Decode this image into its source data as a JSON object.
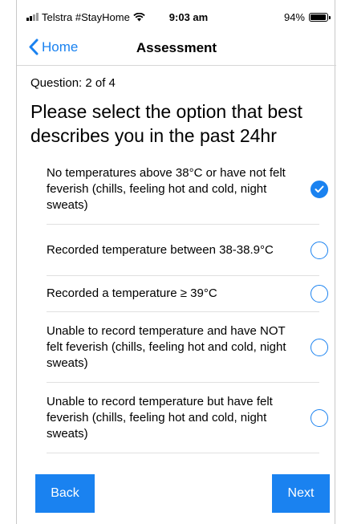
{
  "status_bar": {
    "carrier": "Telstra #StayHome",
    "time": "9:03 am",
    "battery": "94%",
    "battery_level": 0.94
  },
  "nav": {
    "back_label": "Home",
    "title": "Assessment"
  },
  "question": {
    "counter": "Question: 2 of 4",
    "text": "Please select the option that best describes you in the past 24hr"
  },
  "options": [
    {
      "label": "No temperatures above 38°C or have not felt feverish (chills, feeling hot and cold, night sweats)",
      "selected": true
    },
    {
      "label": "Recorded temperature between 38-38.9°C",
      "selected": false
    },
    {
      "label": "Recorded a temperature ≥ 39°C",
      "selected": false
    },
    {
      "label": "Unable to record temperature and have NOT felt feverish (chills, feeling hot and cold, night sweats)",
      "selected": false
    },
    {
      "label": "Unable to record temperature but have felt feverish (chills, feeling hot and cold, night sweats)",
      "selected": false
    }
  ],
  "buttons": {
    "back_label": "Back",
    "next_label": "Next"
  },
  "colors": {
    "accent": "#1a82f0"
  }
}
